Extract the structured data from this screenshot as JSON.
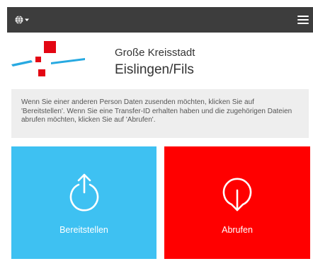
{
  "topbar": {
    "language_icon": "globe-icon",
    "dropdown_icon": "caret-down-icon",
    "menu_icon": "hamburger-menu-icon"
  },
  "header": {
    "org_type": "Große Kreisstadt",
    "org_name": "Eislingen/Fils"
  },
  "info": {
    "text": "Wenn Sie einer anderen Person Daten zusenden möchten, klicken Sie auf 'Bereitstellen'. Wenn Sie eine Transfer-ID erhalten haben und die zugehörigen Dateien abrufen möchten, klicken Sie auf 'Abrufen'."
  },
  "actions": {
    "provide": {
      "label": "Bereitstellen",
      "icon": "upload-icon",
      "color": "#3ec1f2"
    },
    "retrieve": {
      "label": "Abrufen",
      "icon": "download-icon",
      "color": "#ff0000"
    }
  },
  "colors": {
    "topbar": "#3d3d3d",
    "logo_red": "#e30613",
    "logo_blue": "#27a9e1",
    "info_bg": "#eeeeee"
  }
}
